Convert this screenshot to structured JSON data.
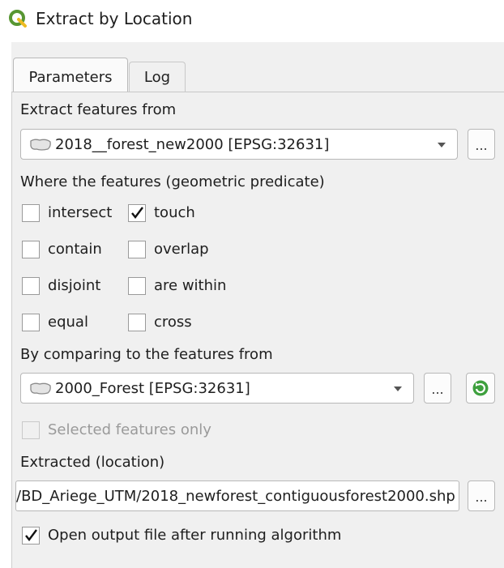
{
  "window": {
    "title": "Extract by Location",
    "logo_icon": "qgis-logo-icon"
  },
  "tabs": [
    {
      "label": "Parameters",
      "active": true
    },
    {
      "label": "Log",
      "active": false
    }
  ],
  "extract_from": {
    "label": "Extract features from",
    "layer": "2018__forest_new2000 [EPSG:32631]",
    "browse_label": "..."
  },
  "predicate": {
    "label": "Where the features (geometric predicate)",
    "options": [
      {
        "label": "intersect",
        "checked": false
      },
      {
        "label": "touch",
        "checked": true
      },
      {
        "label": "contain",
        "checked": false
      },
      {
        "label": "overlap",
        "checked": false
      },
      {
        "label": "disjoint",
        "checked": false
      },
      {
        "label": "are within",
        "checked": false
      },
      {
        "label": "equal",
        "checked": false
      },
      {
        "label": "cross",
        "checked": false
      }
    ]
  },
  "compare": {
    "label": "By comparing to the features from",
    "layer": "2000_Forest [EPSG:32631]",
    "browse_label": "...",
    "iterate_icon": "iterate-icon",
    "selected_only_label": "Selected features only"
  },
  "output": {
    "label": "Extracted (location)",
    "path": "/BD_Ariege_UTM/2018_newforest_contiguousforest2000.shp",
    "browse_label": "...",
    "open_after_label": "Open output file after running algorithm"
  },
  "colors": {
    "qgis_green": "#589632",
    "qgis_yellow": "#ee7913",
    "panel_bg": "#f0f0f0"
  }
}
